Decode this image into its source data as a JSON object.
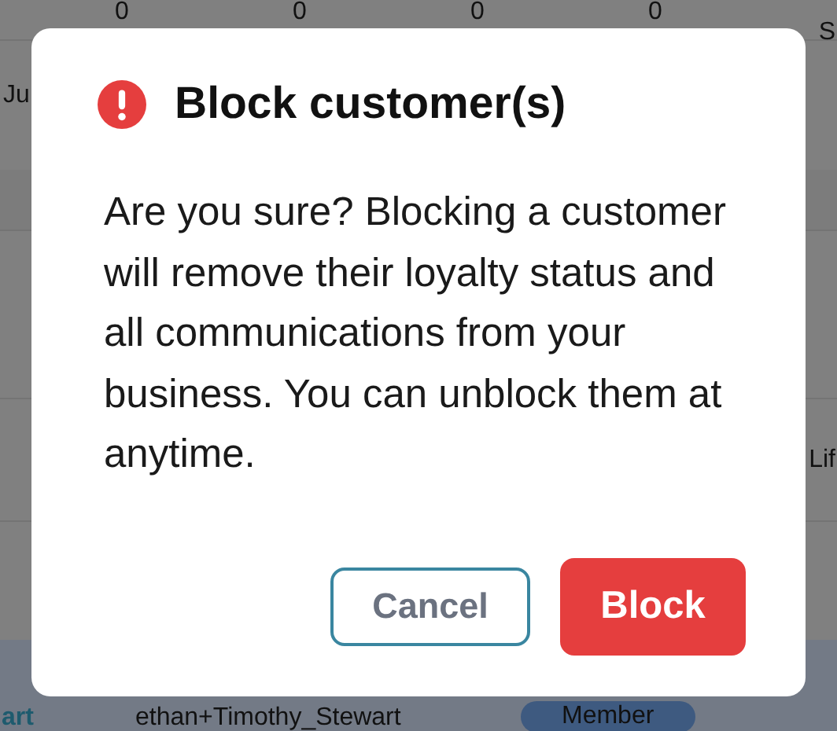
{
  "background": {
    "header_values": [
      "0",
      "0",
      "0",
      "0"
    ],
    "right_header": "S",
    "row_label": "Ju",
    "right_cell": "Lif",
    "footer_row": {
      "name_fragment": "art",
      "username": "ethan+Timothy_Stewart",
      "badge": "Member"
    }
  },
  "dialog": {
    "title": "Block customer(s)",
    "message": "Are you sure? Blocking a customer will remove their loyalty status and all communications from your business. You can unblock them at anytime.",
    "buttons": [
      {
        "label": "Cancel",
        "kind": "secondary"
      },
      {
        "label": "Block",
        "kind": "danger"
      }
    ]
  }
}
